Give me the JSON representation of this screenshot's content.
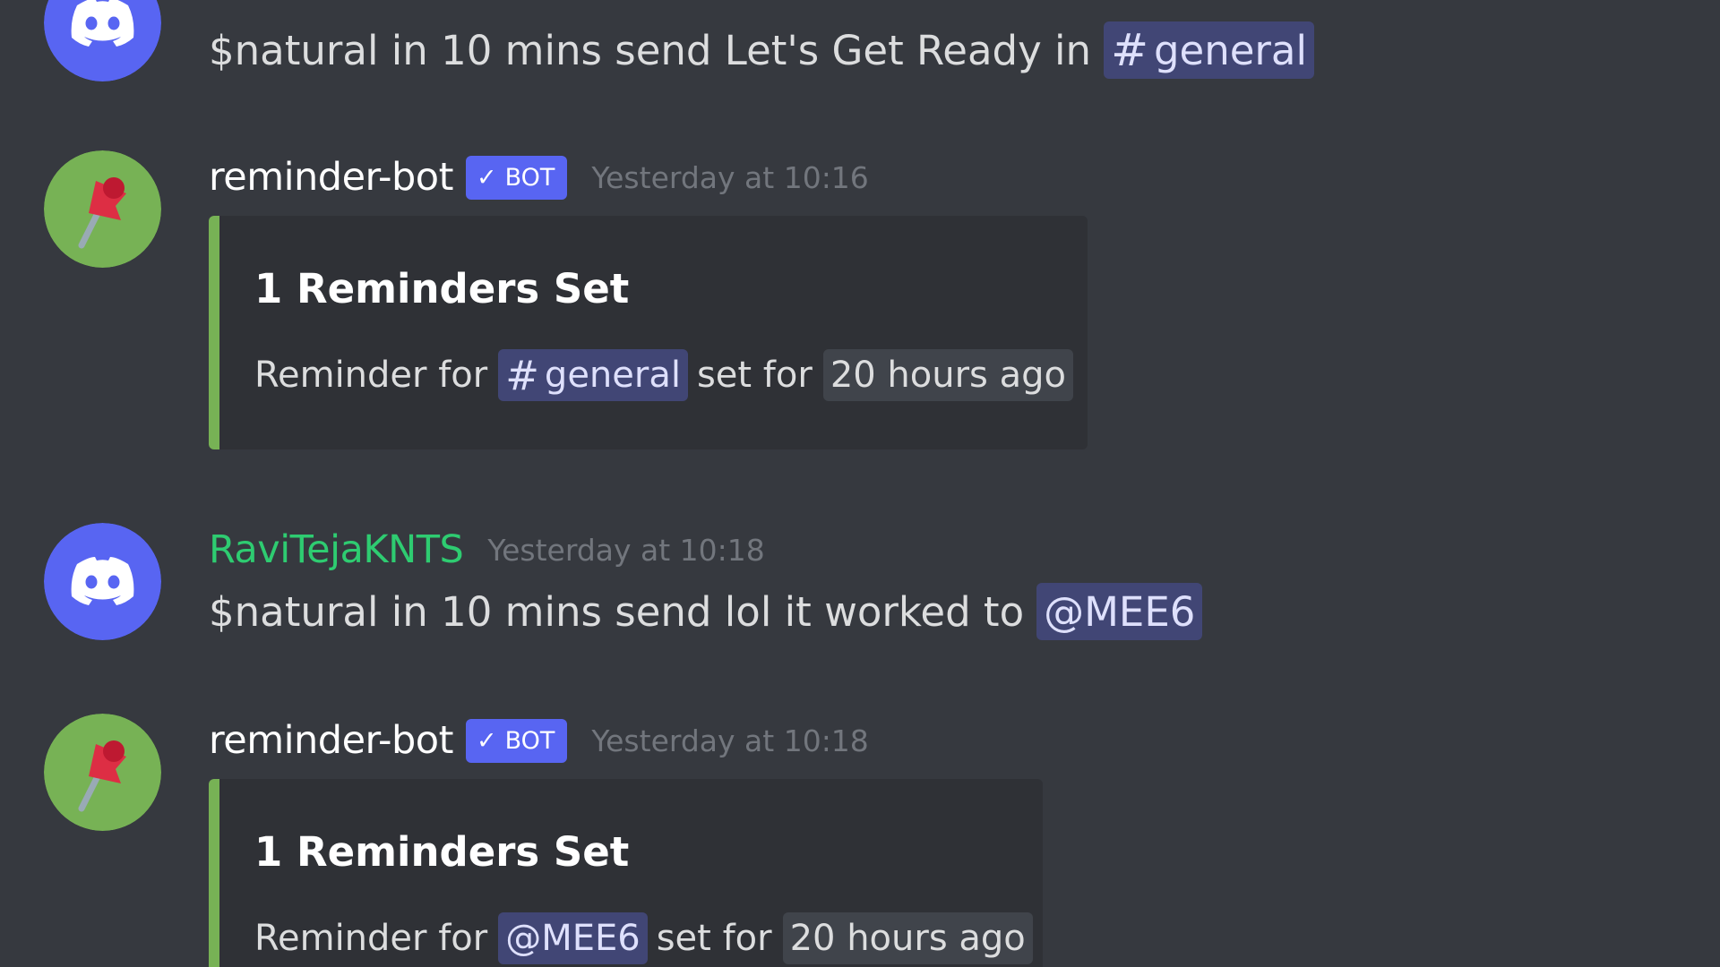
{
  "messages": [
    {
      "text_before": "$natural in 10 mins send Let's Get Ready in",
      "mention_symbol": "#",
      "mention_text": "general"
    },
    {
      "username": "reminder-bot",
      "bot_check": "✓",
      "bot_label": "BOT",
      "timestamp": "Yesterday at 10:16",
      "embed": {
        "title": "1 Reminders Set",
        "desc_prefix": "Reminder for",
        "mention_symbol": "#",
        "mention_text": "general",
        "desc_middle": "set for",
        "time_text": "20 hours ago"
      }
    },
    {
      "username": "RaviTejaKNTS",
      "timestamp": "Yesterday at 10:18",
      "text_before": "$natural in 10 mins send lol it worked to",
      "mention_text": "@MEE6"
    },
    {
      "username": "reminder-bot",
      "bot_check": "✓",
      "bot_label": "BOT",
      "timestamp": "Yesterday at 10:18",
      "embed": {
        "title": "1 Reminders Set",
        "desc_prefix": "Reminder for",
        "mention_text": "@MEE6",
        "desc_middle": "set for",
        "time_text": "20 hours ago"
      }
    }
  ],
  "colors": {
    "background": "#36393f",
    "embed_background": "#2f3136",
    "embed_accent": "#77b255",
    "blurple": "#5865f2",
    "user_green": "#2ecc71",
    "mention_bg": "#414675"
  },
  "icons": {
    "user_avatar": "discord-logo-icon",
    "bot_avatar": "pushpin-icon"
  }
}
